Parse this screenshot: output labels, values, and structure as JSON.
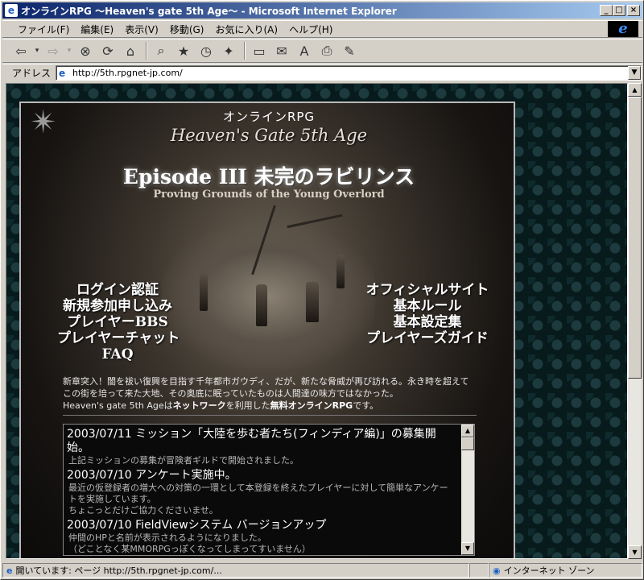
{
  "window": {
    "title": "オンラインRPG ～Heaven's gate 5th Age～ - Microsoft Internet Explorer",
    "icon": "ie-page-icon"
  },
  "menubar": {
    "items": [
      "ファイル(F)",
      "編集(E)",
      "表示(V)",
      "移動(G)",
      "お気に入り(A)",
      "ヘルプ(H)"
    ]
  },
  "toolbar": {
    "buttons": [
      "back-icon",
      "forward-icon",
      "stop-icon",
      "refresh-icon",
      "home-icon",
      "search-icon",
      "favorites-icon",
      "history-icon",
      "channels-icon",
      "fullscreen-icon",
      "mail-icon",
      "font-icon",
      "print-icon",
      "edit-icon"
    ]
  },
  "address": {
    "label": "アドレス",
    "url": "http://5th.rpgnet-jp.com/"
  },
  "page": {
    "subtitle": "オンラインRPG",
    "logo": "Heaven's Gate 5th Age",
    "episode": "Episode III 未完のラビリンス",
    "episode_en": "Proving Grounds of the Young Overlord",
    "nav_left": [
      "ログイン認証",
      "新規参加申し込み",
      "プレイヤーBBS",
      "プレイヤーチャット",
      "FAQ"
    ],
    "nav_right": [
      "オフィシャルサイト",
      "基本ルール",
      "基本設定集",
      "プレイヤーズガイド"
    ],
    "intro_line1": "新章突入！闇を祓い復興を目指す千年都市ガウディ、だが、新たな脅威が再び訪れる。永き時を超えてこの街を培って来た大地、その奥底に眠っていたものは人間達の味方ではなかった。",
    "intro_line2_prefix": "Heaven's gate 5th Ageは",
    "intro_line2_net": "ネットワーク",
    "intro_line2_mid": "を利用した",
    "intro_line2_free": "無料オンラインRPG",
    "intro_line2_suffix": "です。",
    "news": [
      {
        "head": "2003/07/11 ミッション「大陸を歩む者たち(フィンディア編)」の募集開始。",
        "body": "上記ミッションの募集が冒険者ギルドで開始されました。"
      },
      {
        "head": "2003/07/10 アンケート実施中。",
        "body": "最近の仮登録者の増大への対策の一環として本登録を終えたプレイヤーに対して簡単なアンケートを実施しています。\nちょこっとだけご協力くださいませ。"
      },
      {
        "head": "2003/07/10 FieldViewシステム バージョンアップ",
        "body": "仲間のHPと名前が表示されるようになりました。\n（どことなく某MMORPGっぽくなってしまってすいません）"
      }
    ]
  },
  "statusbar": {
    "loading": "開いています: ページ http://5th.rpgnet-jp.com/...",
    "zone": "インターネット ゾーン"
  }
}
